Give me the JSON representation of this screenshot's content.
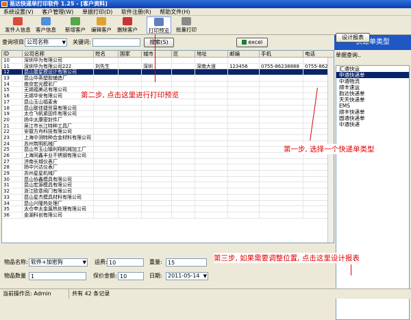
{
  "title": "易达快递单打印软件 1.25 - [客户资料]",
  "menu": [
    "系统设置(V)",
    "客户管理(W)",
    "单据打印(D)",
    "软件注册(R)",
    "帮助文件(H)"
  ],
  "toolbar": [
    "发件人信息",
    "客户信息",
    "新增客户",
    "编辑客户",
    "删除客户",
    "打印预览",
    "批量打印"
  ],
  "search": {
    "item_label": "查询项目:",
    "item_value": "公司名称",
    "keyword_label": "关键词:",
    "keyword_value": "",
    "search_btn": "搜索(S)",
    "excel_btn": "excel"
  },
  "grid": {
    "headers": [
      "ID",
      "公司名称",
      "姓名",
      "国家",
      "城市",
      "区",
      "地址",
      "邮编",
      "手机",
      "电话"
    ],
    "rows": [
      [
        "10",
        "深圳华为有限公司",
        "",
        "",
        "",
        "",
        "",
        "",
        "",
        ""
      ],
      [
        "11",
        "深圳华为有限公司222",
        "刘先生",
        "",
        "深圳",
        "",
        "深南大道",
        "123456",
        "0755-86238888",
        "0755-86238"
      ],
      [
        "12",
        "昆山震星模设计有限公司",
        "",
        "",
        "",
        "",
        "",
        "",
        "",
        ""
      ],
      [
        "13",
        "昆山华英塑胶辅造厂",
        "",
        "",
        "",
        "",
        "",
        "",
        "",
        ""
      ],
      [
        "14",
        "南京宏光模彩厂",
        "",
        "",
        "",
        "",
        "",
        "",
        "",
        ""
      ],
      [
        "15",
        "无锡福美达有限公司",
        "",
        "",
        "",
        "",
        "",
        "",
        "",
        ""
      ],
      [
        "16",
        "无锡华安有限公司",
        "",
        "",
        "",
        "",
        "",
        "",
        "",
        ""
      ],
      [
        "17",
        "昆山玉山福麦舍",
        "",
        "",
        "",
        "",
        "",
        "",
        "",
        ""
      ],
      [
        "18",
        "昆山联佳捷贸易有限公司",
        "",
        "",
        "",
        "",
        "",
        "",
        "",
        ""
      ],
      [
        "19",
        "太仓飞帆紧固件有限公司",
        "",
        "",
        "",
        "",
        "",
        "",
        "",
        ""
      ],
      [
        "20",
        "扬中太康密封件厂",
        "",
        "",
        "",
        "",
        "",
        "",
        "",
        ""
      ],
      [
        "21",
        "吴江市长江特种工具厂",
        "",
        "",
        "",
        "",
        "",
        "",
        "",
        ""
      ],
      [
        "22",
        "安徽方舟科技有限公司",
        "",
        "",
        "",
        "",
        "",
        "",
        "",
        ""
      ],
      [
        "23",
        "上海中测特种合金材料有限公司",
        "",
        "",
        "",
        "",
        "",
        "",
        "",
        ""
      ],
      [
        "24",
        "苏州筑明机械厂",
        "",
        "",
        "",
        "",
        "",
        "",
        "",
        ""
      ],
      [
        "25",
        "昆山市玉山镇利翔机械加工厂",
        "",
        "",
        "",
        "",
        "",
        "",
        "",
        ""
      ],
      [
        "26",
        "上海同鑫丰业不锈钢有限公司",
        "",
        "",
        "",
        "",
        "",
        "",
        "",
        ""
      ],
      [
        "27",
        "济南长城仪表厂",
        "",
        "",
        "",
        "",
        "",
        "",
        "",
        ""
      ],
      [
        "28",
        "扬中兴达仪表厂",
        "",
        "",
        "",
        "",
        "",
        "",
        "",
        ""
      ],
      [
        "29",
        "苏州星星机械厂",
        "",
        "",
        "",
        "",
        "",
        "",
        "",
        ""
      ],
      [
        "30",
        "昆山协鑫模具有限公司",
        "",
        "",
        "",
        "",
        "",
        "",
        "",
        ""
      ],
      [
        "31",
        "昆山宏源模具有限公司",
        "",
        "",
        "",
        "",
        "",
        "",
        "",
        ""
      ],
      [
        "32",
        "浙江欧意阀门有限公司",
        "",
        "",
        "",
        "",
        "",
        "",
        "",
        ""
      ],
      [
        "33",
        "昆山星杰模具材料有限公司",
        "",
        "",
        "",
        "",
        "",
        "",
        "",
        ""
      ],
      [
        "34",
        "昆山兴隆热处理厂",
        "",
        "",
        "",
        "",
        "",
        "",
        "",
        ""
      ],
      [
        "35",
        "太仓申太金属热处理有限公司",
        "",
        "",
        "",
        "",
        "",
        "",
        "",
        ""
      ],
      [
        "36",
        "金湖科创有限公司",
        "",
        "",
        "",
        "",
        "",
        "",
        "",
        ""
      ]
    ]
  },
  "right": {
    "header": "快递单类型",
    "search_label": "单据查询..",
    "items": [
      "汇通快运",
      "申通快递单",
      "中通物流",
      "顺丰速运",
      "韵达快递单",
      "天天快递单",
      "EMS",
      "顺丰快递单",
      "圆通快递单",
      "中通快递"
    ],
    "selected": 1
  },
  "bottom": {
    "goods_name_label": "物品名称:",
    "goods_name_value": "软件+加密狗",
    "freight_label": "运费:",
    "freight_value": "10",
    "weight_label": "重量:",
    "weight_value": "15",
    "qty_label": "物品数量",
    "qty_value": "1",
    "insured_label": "保价金额:",
    "insured_value": "10",
    "date_label": "日期:",
    "date_value": "2011-05-14",
    "design_btn": "设计报表"
  },
  "status": {
    "operator": "当前操作员: Admin",
    "records": "共有 42 条记录"
  },
  "notes": {
    "step2": "第二步, 点击这里进行打印预览",
    "step1": "第一步, 选择一个快递单类型",
    "step3": "第三步, 如果需要调整位置, 点击这里设计报表"
  }
}
